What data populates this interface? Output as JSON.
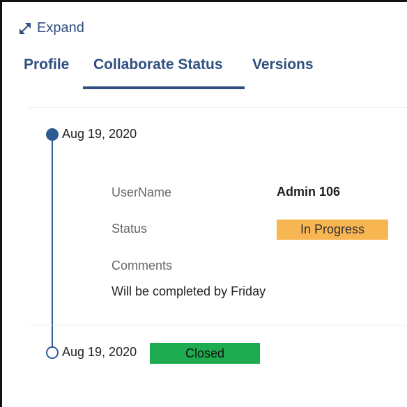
{
  "header": {
    "expand_label": "Expand"
  },
  "tabs": [
    {
      "label": "Profile",
      "active": false
    },
    {
      "label": "Collaborate Status",
      "active": true
    },
    {
      "label": "Versions",
      "active": false
    }
  ],
  "timeline": [
    {
      "date": "Aug 19, 2020",
      "marker": "filled",
      "details": {
        "username_label": "UserName",
        "username_value": "Admin 106",
        "status_label": "Status",
        "status_value": "In Progress",
        "status_color": "#f8b652",
        "comments_label": "Comments",
        "comments_value": "Will be completed by Friday"
      }
    },
    {
      "date": "Aug 19, 2020",
      "marker": "hollow",
      "status_value": "Closed",
      "status_color": "#1fab4f"
    }
  ],
  "colors": {
    "accent": "#2f4f7f",
    "timeline": "#2f5b94"
  }
}
